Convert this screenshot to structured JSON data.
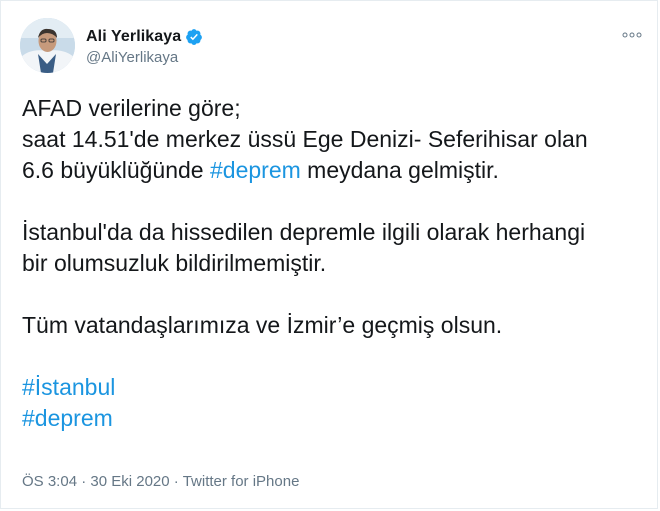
{
  "author": {
    "display_name": "Ali Yerlikaya",
    "handle": "@AliYerlikaya",
    "verified": true
  },
  "tweet": {
    "line1": "AFAD verilerine göre;",
    "line2": "saat 14.51'de merkez üssü Ege Denizi- Seferihisar olan",
    "line3_before": "6.6 büyüklüğünde ",
    "line3_hashtag": "#deprem",
    "line3_after": " meydana gelmiştir.",
    "para2_line1": "İstanbul'da da hissedilen depremle ilgili olarak herhangi",
    "para2_line2": "bir olumsuzluk bildirilmemiştir.",
    "para3": "Tüm vatandaşlarımıza ve İzmir’e geçmiş olsun.",
    "hashtag1": "#İstanbul",
    "hashtag2": "#deprem"
  },
  "meta": {
    "time": "ÖS 3:04",
    "separator": " · ",
    "date": "30 Eki 2020",
    "source": "Twitter for iPhone"
  },
  "icons": {
    "verified": "verified-badge-icon",
    "more": "more-options-icon"
  },
  "colors": {
    "hashtag": "#1b95e0",
    "secondary_text": "#657786",
    "primary_text": "#14171a",
    "verified": "#1da1f2"
  }
}
